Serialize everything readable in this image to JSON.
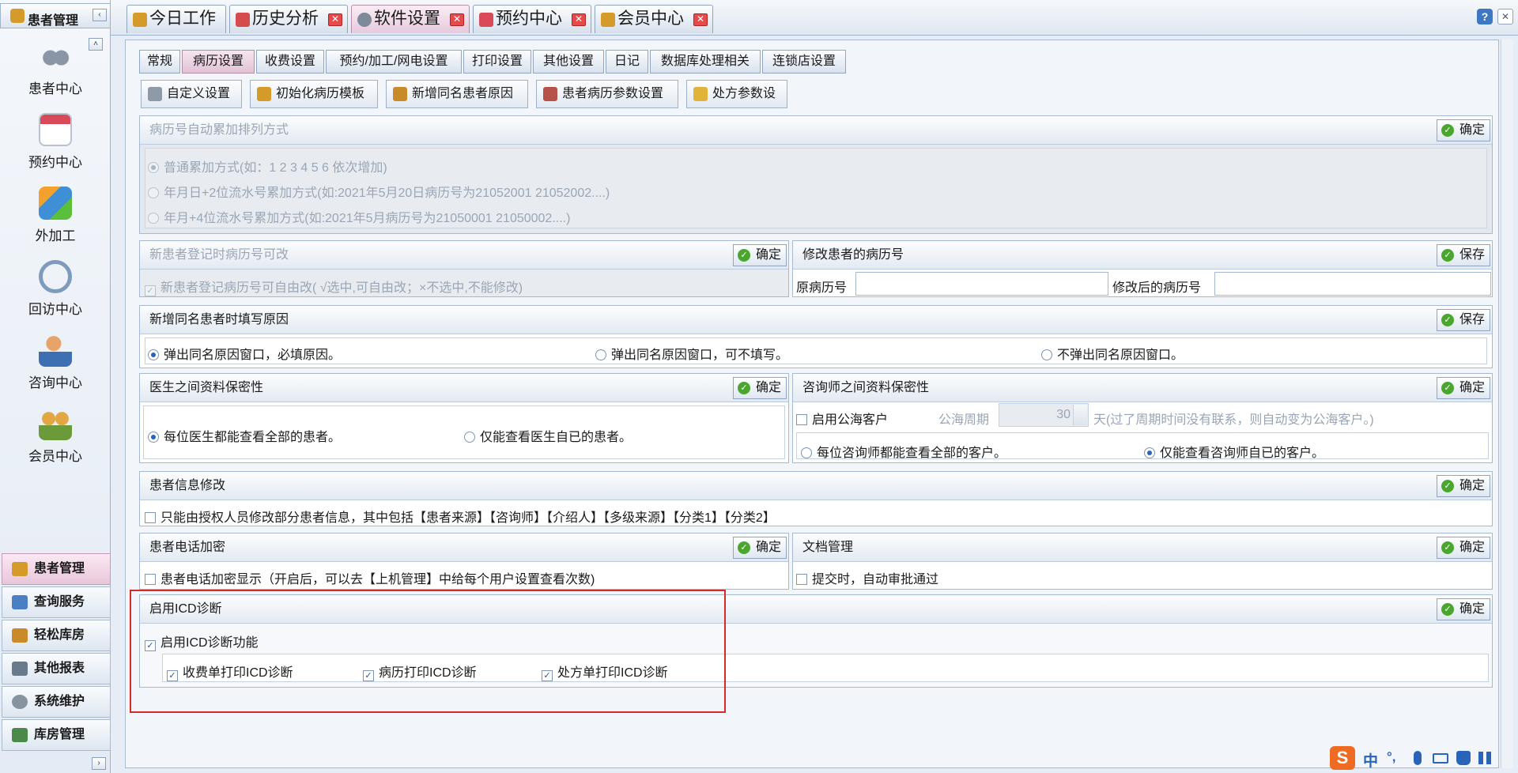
{
  "sidebar": {
    "title": "患者管理",
    "collapse_arrow": "‹",
    "up_arrow": "˄",
    "nav": [
      {
        "label": "患者中心",
        "icon": "binoculars-icon",
        "color": "#6f7c8e"
      },
      {
        "label": "预约中心",
        "icon": "calendar-icon",
        "color": "#d84a5a"
      },
      {
        "label": "外加工",
        "icon": "cubes-icon",
        "color": "#3e8fd6"
      },
      {
        "label": "回访中心",
        "icon": "refresh-icon",
        "color": "#5f7ea3"
      },
      {
        "label": "咨询中心",
        "icon": "user-calendar-icon",
        "color": "#c77a3c"
      },
      {
        "label": "会员中心",
        "icon": "users-icon",
        "color": "#d49a2a"
      }
    ],
    "bottom": [
      {
        "label": "患者管理",
        "color": "#d49a2a",
        "active": true
      },
      {
        "label": "查询服务",
        "color": "#4b7fc4"
      },
      {
        "label": "轻松库房",
        "color": "#c98b2a"
      },
      {
        "label": "其他报表",
        "color": "#6a7a8d"
      },
      {
        "label": "系统维护",
        "color": "#8893a0"
      },
      {
        "label": "库房管理",
        "color": "#4b8a4a"
      }
    ],
    "expand_arrow": "›"
  },
  "top_tabs": [
    {
      "label": "今日工作",
      "icon": "home-icon",
      "closable": false
    },
    {
      "label": "历史分析",
      "icon": "chart-icon",
      "closable": true
    },
    {
      "label": "软件设置",
      "icon": "settings-icon",
      "closable": true,
      "active": true
    },
    {
      "label": "预约中心",
      "icon": "calendar-icon",
      "closable": true
    },
    {
      "label": "会员中心",
      "icon": "users-icon",
      "closable": true
    }
  ],
  "close_x": "✕",
  "help": "?",
  "sub_tabs": [
    "常规",
    "病历设置",
    "收费设置",
    "预约/加工/网电设置",
    "打印设置",
    "其他设置",
    "日记",
    "数据库处理相关",
    "连锁店设置"
  ],
  "toolbar": [
    "自定义设置",
    "初始化病历模板",
    "新增同名患者原因",
    "患者病历参数设置",
    "处方参数设"
  ],
  "ok_label": "确定",
  "save_label": "保存",
  "check": "✓",
  "mark": "✓",
  "p_auto": {
    "title": "病历号自动累加排列方式",
    "options": [
      "普通累加方式(如：1  2  3  4  5  6 依次增加)",
      "年月日+2位流水号累加方式(如:2021年5月20日病历号为21052001 21052002....)",
      "年月+4位流水号累加方式(如:2021年5月病历号为21050001 21050002....)"
    ]
  },
  "p_new": {
    "title": "新患者登记时病历号可改",
    "option": "新患者登记病历号可自由改( √选中,可自由改；×不选中,不能修改)"
  },
  "p_modify": {
    "title": "修改患者的病历号",
    "orig": "原病历号",
    "after": "修改后的病历号"
  },
  "p_same": {
    "title": "新增同名患者时填写原因",
    "options": [
      "弹出同名原因窗口，必填原因。",
      "弹出同名原因窗口，可不填写。",
      "不弹出同名原因窗口。"
    ]
  },
  "p_doctor": {
    "title": "医生之间资料保密性",
    "options": [
      "每位医生都能查看全部的患者。",
      "仅能查看医生自已的患者。"
    ]
  },
  "p_consult": {
    "title": "咨询师之间资料保密性",
    "enable": "启用公海客户",
    "period_label": "公海周期",
    "period_value": "30",
    "period_note": "天(过了周期时间没有联系，则自动变为公海客户。)",
    "options": [
      "每位咨询师都能查看全部的客户。",
      "仅能查看咨询师自已的客户。"
    ]
  },
  "p_info": {
    "title": "患者信息修改",
    "option": "只能由授权人员修改部分患者信息，其中包括【患者来源】【咨询师】【介绍人】【多级来源】【分类1】【分类2】"
  },
  "p_phone": {
    "title": "患者电话加密",
    "option": "患者电话加密显示（开启后，可以去【上机管理】中给每个用户设置查看次数)"
  },
  "p_doc": {
    "title": "文档管理",
    "option": "提交时，自动审批通过"
  },
  "p_icd": {
    "title": "启用ICD诊断",
    "enable": "启用ICD诊断功能",
    "subs": [
      "收费单打印ICD诊断",
      "病历打印ICD诊断",
      "处方单打印ICD诊断"
    ]
  },
  "ime": {
    "logo": "S",
    "lang": "中",
    "punct": "°,"
  }
}
